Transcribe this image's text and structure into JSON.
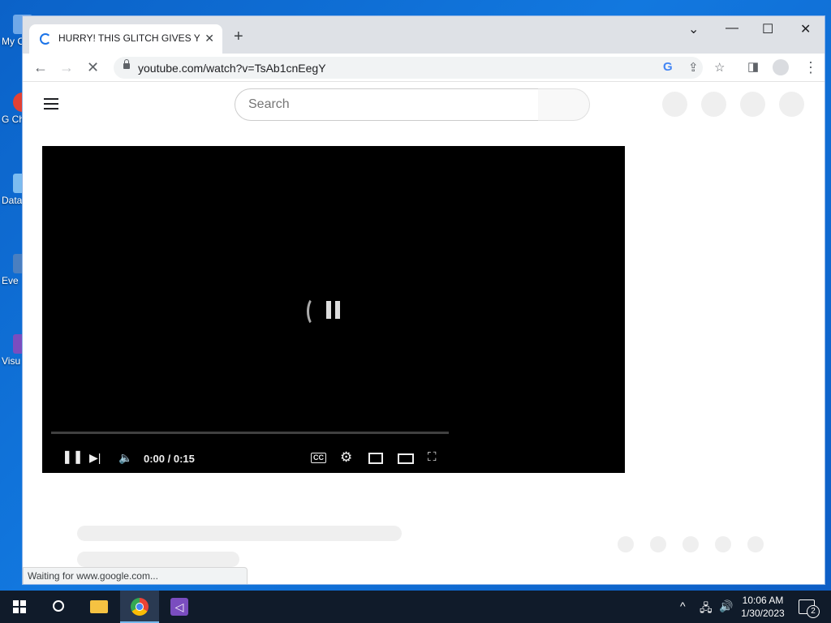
{
  "desktop": {
    "icons": [
      {
        "label": "My C",
        "color": "#6fa8e8"
      },
      {
        "label": "G Ch",
        "color": "#e34133"
      },
      {
        "label": "Data",
        "color": "#7cbcf0"
      },
      {
        "label": "Eve",
        "color": "#4a7fc0"
      },
      {
        "label": "Visu",
        "color": "#7a4dbf"
      }
    ]
  },
  "browser": {
    "tab": {
      "title": "HURRY! THIS GLITCH GIVES YOU",
      "close": "✕"
    },
    "new_tab": "+",
    "window_controls": {
      "menu": "⌄",
      "minimize": "—",
      "maximize": "☐",
      "close": "✕"
    },
    "toolbar": {
      "back": "←",
      "forward": "→",
      "stop": "✕",
      "url": "youtube.com/watch?v=TsAb1cnEegY"
    },
    "toolbar_icons": [
      "google-icon",
      "share-icon",
      "star-icon",
      "sidebar-icon",
      "profile-icon",
      "menu-icon"
    ]
  },
  "youtube": {
    "search_placeholder": "Search",
    "player": {
      "time": "0:00 / 0:15",
      "progress_fraction": 0.0
    }
  },
  "status_bar": "Waiting for www.google.com...",
  "taskbar": {
    "clock_time": "10:06 AM",
    "clock_date": "1/30/2023",
    "notification_count": "2",
    "apps": [
      "start",
      "search",
      "file-explorer",
      "chrome",
      "visual-studio"
    ]
  },
  "colors": {
    "accent": "#1a73e8",
    "taskbar": "#101b2a",
    "player": "#000000"
  }
}
